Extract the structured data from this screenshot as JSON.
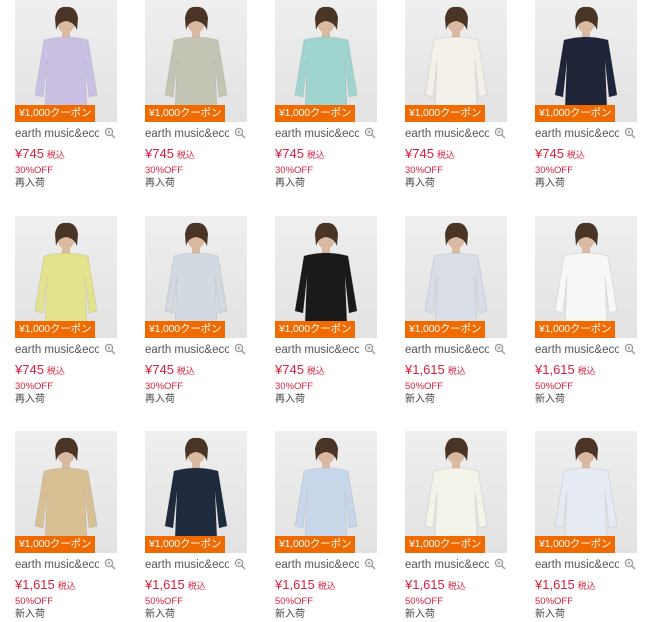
{
  "products": [
    {
      "brand": "earth music&ecology",
      "coupon": "¥1,000クーポン",
      "price": "¥745",
      "tax": "税込",
      "discount": "30%OFF",
      "status": "再入荷",
      "color": "#c9c0e4"
    },
    {
      "brand": "earth music&ecology",
      "coupon": "¥1,000クーポン",
      "price": "¥745",
      "tax": "税込",
      "discount": "30%OFF",
      "status": "再入荷",
      "color": "#c4c4b4"
    },
    {
      "brand": "earth music&ecology",
      "coupon": "¥1,000クーポン",
      "price": "¥745",
      "tax": "税込",
      "discount": "30%OFF",
      "status": "再入荷",
      "color": "#9fd4cf"
    },
    {
      "brand": "earth music&ecology",
      "coupon": "¥1,000クーポン",
      "price": "¥745",
      "tax": "税込",
      "discount": "30%OFF",
      "status": "再入荷",
      "color": "#f4f1ea"
    },
    {
      "brand": "earth music&ecology",
      "coupon": "¥1,000クーポン",
      "price": "¥745",
      "tax": "税込",
      "discount": "30%OFF",
      "status": "再入荷",
      "color": "#1f2538"
    },
    {
      "brand": "earth music&ecology",
      "coupon": "¥1,000クーポン",
      "price": "¥745",
      "tax": "税込",
      "discount": "30%OFF",
      "status": "再入荷",
      "color": "#e3e38e"
    },
    {
      "brand": "earth music&ecology",
      "coupon": "¥1,000クーポン",
      "price": "¥745",
      "tax": "税込",
      "discount": "30%OFF",
      "status": "再入荷",
      "color": "#d3d9e0"
    },
    {
      "brand": "earth music&ecology",
      "coupon": "¥1,000クーポン",
      "price": "¥745",
      "tax": "税込",
      "discount": "30%OFF",
      "status": "再入荷",
      "color": "#1a1a1a"
    },
    {
      "brand": "earth music&ecology",
      "coupon": "¥1,000クーポン",
      "price": "¥1,615",
      "tax": "税込",
      "discount": "50%OFF",
      "status": "新入荷",
      "color": "#d9dde6"
    },
    {
      "brand": "earth music&ecology",
      "coupon": "¥1,000クーポン",
      "price": "¥1,615",
      "tax": "税込",
      "discount": "50%OFF",
      "status": "新入荷",
      "color": "#f7f7f5"
    },
    {
      "brand": "earth music&ecology",
      "coupon": "¥1,000クーポン",
      "price": "¥1,615",
      "tax": "税込",
      "discount": "50%OFF",
      "status": "新入荷",
      "color": "#d8bf94"
    },
    {
      "brand": "earth music&ecology",
      "coupon": "¥1,000クーポン",
      "price": "¥1,615",
      "tax": "税込",
      "discount": "50%OFF",
      "status": "新入荷",
      "color": "#1f2a3d"
    },
    {
      "brand": "earth music&ecology",
      "coupon": "¥1,000クーポン",
      "price": "¥1,615",
      "tax": "税込",
      "discount": "50%OFF",
      "status": "新入荷",
      "color": "#c8d6ea"
    },
    {
      "brand": "earth music&ecology",
      "coupon": "¥1,000クーポン",
      "price": "¥1,615",
      "tax": "税込",
      "discount": "50%OFF",
      "status": "新入荷",
      "color": "#f3f3ea"
    },
    {
      "brand": "earth music&ecology",
      "coupon": "¥1,000クーポン",
      "price": "¥1,615",
      "tax": "税込",
      "discount": "50%OFF",
      "status": "新入荷",
      "color": "#e6ebf3"
    }
  ],
  "icons": {
    "zoom": "zoom-in-icon"
  },
  "colors": {
    "coupon": "#ef6a00",
    "price": "#d81e3c"
  }
}
